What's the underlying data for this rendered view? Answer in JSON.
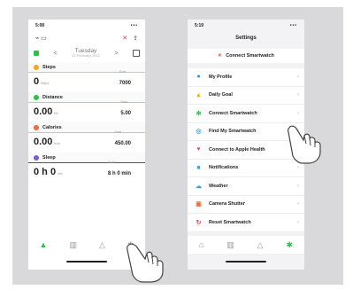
{
  "left_phone": {
    "status_time": "5:08",
    "status_signal": "•••",
    "date_day": "Tuesday",
    "date_full": "22 February 2022",
    "metrics": [
      {
        "name": "Steps",
        "value": "0",
        "unit": "Steps",
        "goal_label": "Goal",
        "goal": "7000",
        "color": "#f2a81d",
        "underline": "#f2c26a"
      },
      {
        "name": "Distance",
        "value": "0.00",
        "unit": "km",
        "goal_label": "Goal",
        "goal": "5.00",
        "color": "#2fbf4a",
        "underline": "#9fd8a8"
      },
      {
        "name": "Calories",
        "value": "0.00",
        "unit": "kcal",
        "goal_label": "Goal",
        "goal": "450.00",
        "color": "#f06b3a",
        "underline": "#f5b59b"
      },
      {
        "name": "Sleep",
        "value": "0 h 0",
        "unit": "min",
        "goal_label": "Goal",
        "goal": "8 h 0 min",
        "color": "#7a5bd6",
        "underline": "#555555"
      }
    ],
    "tabs": [
      "home-icon",
      "chart-icon",
      "bell-icon",
      "gear-icon"
    ]
  },
  "right_phone": {
    "status_time": "5:19",
    "title": "Settings",
    "connect_banner": "Connect Smartwatch",
    "items": [
      {
        "label": "My Profile",
        "icon": "●",
        "color": "#2e8fe0"
      },
      {
        "label": "Daily Goal",
        "icon": "▲",
        "color": "#f2a81d"
      },
      {
        "label": "Connect Smartwatch",
        "icon": "✻",
        "color": "#2fbf4a"
      },
      {
        "label": "Find My Smartwatch",
        "icon": "◎",
        "color": "#3aa0e8"
      },
      {
        "label": "Connect to Apple Health",
        "icon": "♥",
        "color": "#e84a6a"
      },
      {
        "label": "Notifications",
        "icon": "■",
        "color": "#3aa0e8"
      },
      {
        "label": "Weather",
        "icon": "☁",
        "color": "#3aa0e8"
      },
      {
        "label": "Camera Shutter",
        "icon": "▣",
        "color": "#f06b3a"
      },
      {
        "label": "Reset Smartwatch",
        "icon": "↻",
        "color": "#e0473a"
      }
    ],
    "tabs": [
      "home-icon",
      "chart-icon",
      "bell-icon",
      "gear-icon"
    ]
  }
}
